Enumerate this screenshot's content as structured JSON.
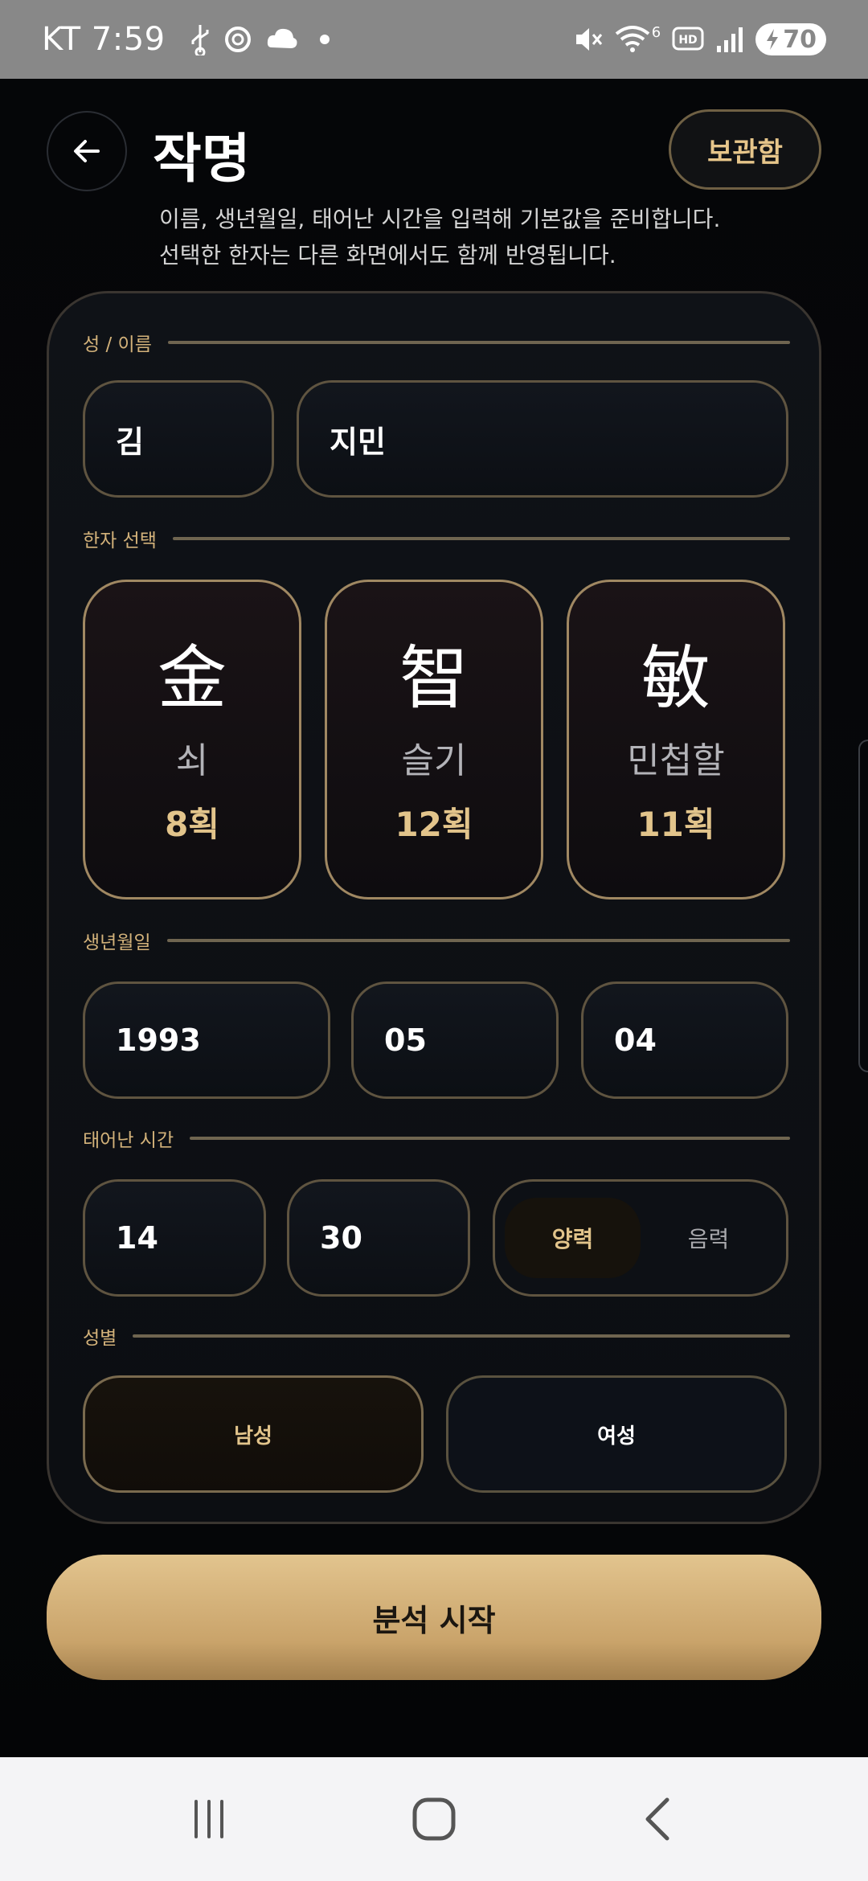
{
  "status_bar": {
    "carrier": "KT",
    "time": "7:59",
    "battery": "70",
    "network_badge": "6"
  },
  "header": {
    "title": "작명",
    "archive_label": "보관함",
    "subtitle_line1": "이름, 생년월일, 태어난 시간을 입력해 기본값을 준비합니다.",
    "subtitle_line2": "선택한 한자는 다른 화면에서도 함께 반영됩니다."
  },
  "form": {
    "name_section_label": "성 / 이름",
    "surname": "김",
    "given_name": "지민",
    "hanja_section_label": "한자 선택",
    "hanja": [
      {
        "char": "金",
        "meaning": "쇠",
        "strokes": "8획"
      },
      {
        "char": "智",
        "meaning": "슬기",
        "strokes": "12획"
      },
      {
        "char": "敏",
        "meaning": "민첩할",
        "strokes": "11획"
      }
    ],
    "birth_section_label": "생년월일",
    "birth_year": "1993",
    "birth_month": "05",
    "birth_day": "04",
    "time_section_label": "태어난 시간",
    "birth_hour": "14",
    "birth_minute": "30",
    "calendar_options": [
      "양력",
      "음력"
    ],
    "calendar_selected": "양력",
    "gender_section_label": "성별",
    "gender_options": [
      "남성",
      "여성"
    ],
    "gender_selected": "남성"
  },
  "actions": {
    "start_label": "분석 시작"
  },
  "colors": {
    "accent_gold": "#e2c48b",
    "button_gold": "#d4b17a",
    "background": "#000000"
  }
}
